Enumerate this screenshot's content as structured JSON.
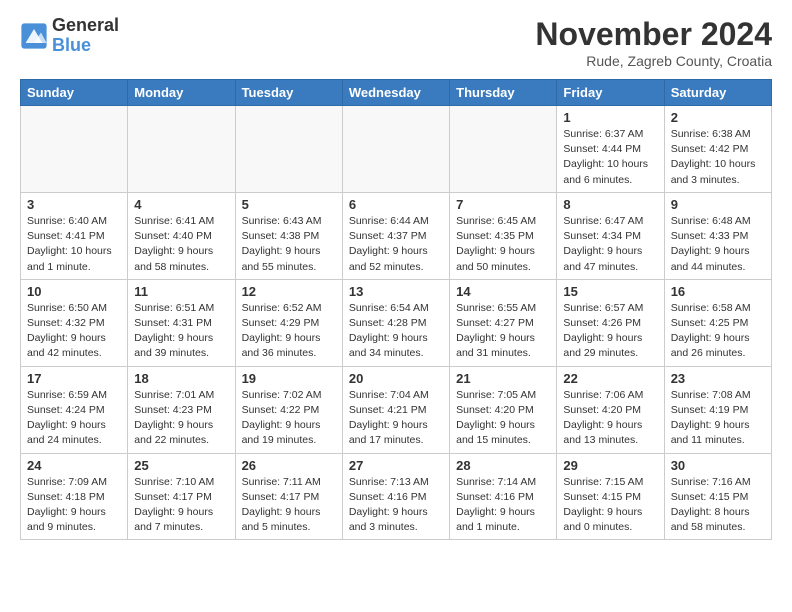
{
  "logo": {
    "general": "General",
    "blue": "Blue"
  },
  "title": "November 2024",
  "location": "Rude, Zagreb County, Croatia",
  "days_header": [
    "Sunday",
    "Monday",
    "Tuesday",
    "Wednesday",
    "Thursday",
    "Friday",
    "Saturday"
  ],
  "weeks": [
    [
      {
        "num": "",
        "info": ""
      },
      {
        "num": "",
        "info": ""
      },
      {
        "num": "",
        "info": ""
      },
      {
        "num": "",
        "info": ""
      },
      {
        "num": "",
        "info": ""
      },
      {
        "num": "1",
        "info": "Sunrise: 6:37 AM\nSunset: 4:44 PM\nDaylight: 10 hours and 6 minutes."
      },
      {
        "num": "2",
        "info": "Sunrise: 6:38 AM\nSunset: 4:42 PM\nDaylight: 10 hours and 3 minutes."
      }
    ],
    [
      {
        "num": "3",
        "info": "Sunrise: 6:40 AM\nSunset: 4:41 PM\nDaylight: 10 hours and 1 minute."
      },
      {
        "num": "4",
        "info": "Sunrise: 6:41 AM\nSunset: 4:40 PM\nDaylight: 9 hours and 58 minutes."
      },
      {
        "num": "5",
        "info": "Sunrise: 6:43 AM\nSunset: 4:38 PM\nDaylight: 9 hours and 55 minutes."
      },
      {
        "num": "6",
        "info": "Sunrise: 6:44 AM\nSunset: 4:37 PM\nDaylight: 9 hours and 52 minutes."
      },
      {
        "num": "7",
        "info": "Sunrise: 6:45 AM\nSunset: 4:35 PM\nDaylight: 9 hours and 50 minutes."
      },
      {
        "num": "8",
        "info": "Sunrise: 6:47 AM\nSunset: 4:34 PM\nDaylight: 9 hours and 47 minutes."
      },
      {
        "num": "9",
        "info": "Sunrise: 6:48 AM\nSunset: 4:33 PM\nDaylight: 9 hours and 44 minutes."
      }
    ],
    [
      {
        "num": "10",
        "info": "Sunrise: 6:50 AM\nSunset: 4:32 PM\nDaylight: 9 hours and 42 minutes."
      },
      {
        "num": "11",
        "info": "Sunrise: 6:51 AM\nSunset: 4:31 PM\nDaylight: 9 hours and 39 minutes."
      },
      {
        "num": "12",
        "info": "Sunrise: 6:52 AM\nSunset: 4:29 PM\nDaylight: 9 hours and 36 minutes."
      },
      {
        "num": "13",
        "info": "Sunrise: 6:54 AM\nSunset: 4:28 PM\nDaylight: 9 hours and 34 minutes."
      },
      {
        "num": "14",
        "info": "Sunrise: 6:55 AM\nSunset: 4:27 PM\nDaylight: 9 hours and 31 minutes."
      },
      {
        "num": "15",
        "info": "Sunrise: 6:57 AM\nSunset: 4:26 PM\nDaylight: 9 hours and 29 minutes."
      },
      {
        "num": "16",
        "info": "Sunrise: 6:58 AM\nSunset: 4:25 PM\nDaylight: 9 hours and 26 minutes."
      }
    ],
    [
      {
        "num": "17",
        "info": "Sunrise: 6:59 AM\nSunset: 4:24 PM\nDaylight: 9 hours and 24 minutes."
      },
      {
        "num": "18",
        "info": "Sunrise: 7:01 AM\nSunset: 4:23 PM\nDaylight: 9 hours and 22 minutes."
      },
      {
        "num": "19",
        "info": "Sunrise: 7:02 AM\nSunset: 4:22 PM\nDaylight: 9 hours and 19 minutes."
      },
      {
        "num": "20",
        "info": "Sunrise: 7:04 AM\nSunset: 4:21 PM\nDaylight: 9 hours and 17 minutes."
      },
      {
        "num": "21",
        "info": "Sunrise: 7:05 AM\nSunset: 4:20 PM\nDaylight: 9 hours and 15 minutes."
      },
      {
        "num": "22",
        "info": "Sunrise: 7:06 AM\nSunset: 4:20 PM\nDaylight: 9 hours and 13 minutes."
      },
      {
        "num": "23",
        "info": "Sunrise: 7:08 AM\nSunset: 4:19 PM\nDaylight: 9 hours and 11 minutes."
      }
    ],
    [
      {
        "num": "24",
        "info": "Sunrise: 7:09 AM\nSunset: 4:18 PM\nDaylight: 9 hours and 9 minutes."
      },
      {
        "num": "25",
        "info": "Sunrise: 7:10 AM\nSunset: 4:17 PM\nDaylight: 9 hours and 7 minutes."
      },
      {
        "num": "26",
        "info": "Sunrise: 7:11 AM\nSunset: 4:17 PM\nDaylight: 9 hours and 5 minutes."
      },
      {
        "num": "27",
        "info": "Sunrise: 7:13 AM\nSunset: 4:16 PM\nDaylight: 9 hours and 3 minutes."
      },
      {
        "num": "28",
        "info": "Sunrise: 7:14 AM\nSunset: 4:16 PM\nDaylight: 9 hours and 1 minute."
      },
      {
        "num": "29",
        "info": "Sunrise: 7:15 AM\nSunset: 4:15 PM\nDaylight: 9 hours and 0 minutes."
      },
      {
        "num": "30",
        "info": "Sunrise: 7:16 AM\nSunset: 4:15 PM\nDaylight: 8 hours and 58 minutes."
      }
    ]
  ]
}
